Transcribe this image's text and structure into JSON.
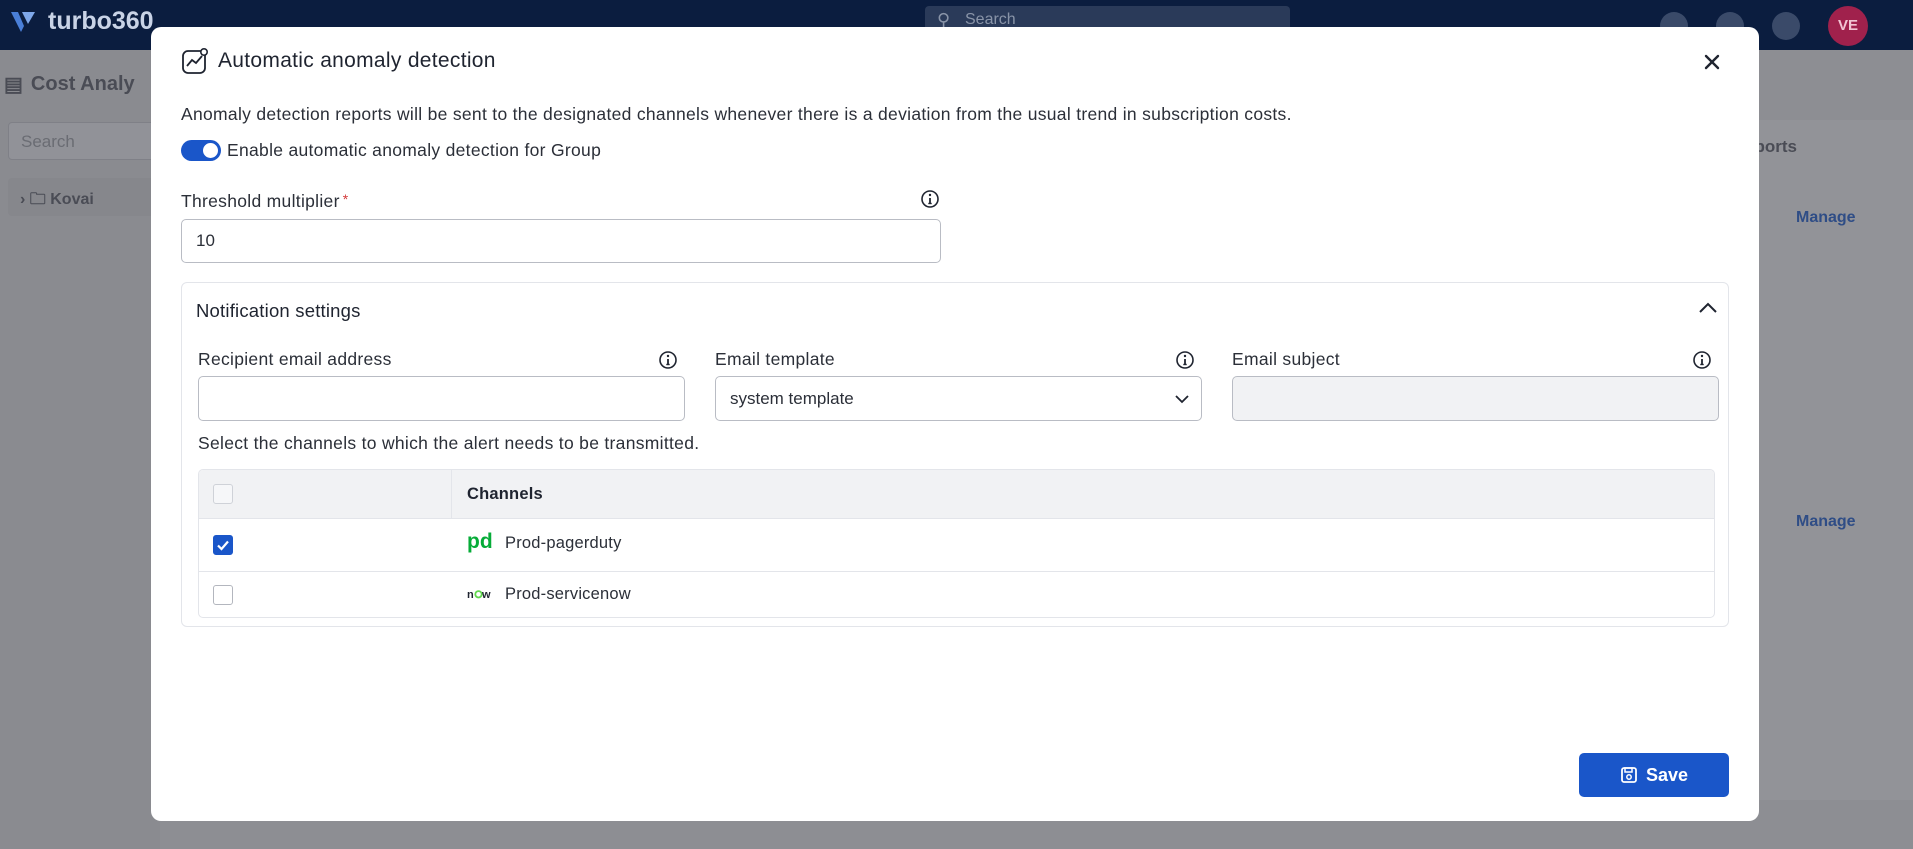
{
  "app": {
    "brand": "turbo360",
    "search_placeholder": "Search",
    "avatar_initials": "VE",
    "background_title": "Cost Analy",
    "sidebar_search_placeholder": "Search",
    "tree_item": "Kovai",
    "reports_tab": "eports",
    "manage_link_1": "Manage",
    "manage_link_2": "Manage"
  },
  "modal": {
    "title": "Automatic anomaly detection",
    "description": "Anomaly detection reports will be sent to the designated channels whenever there is a deviation from the usual trend in subscription costs.",
    "toggle": {
      "label": "Enable automatic anomaly detection for Group",
      "on": true
    },
    "threshold": {
      "label": "Threshold multiplier",
      "required_mark": "*",
      "value": "10"
    },
    "notification": {
      "title": "Notification settings",
      "recipient": {
        "label": "Recipient email address",
        "value": ""
      },
      "template": {
        "label": "Email template",
        "value": "system template"
      },
      "subject": {
        "label": "Email subject",
        "value": ""
      },
      "channels_description": "Select the channels to which the alert needs to be transmitted.",
      "table": {
        "column_header": "Channels",
        "rows": [
          {
            "name": "Prod-pagerduty",
            "icon": "pagerduty-icon",
            "checked": true
          },
          {
            "name": "Prod-servicenow",
            "icon": "servicenow-icon",
            "checked": false
          }
        ]
      }
    },
    "save_label": "Save"
  },
  "colors": {
    "primary": "#1a56c9",
    "pagerduty": "#06ac38",
    "required": "#d33a3a"
  }
}
